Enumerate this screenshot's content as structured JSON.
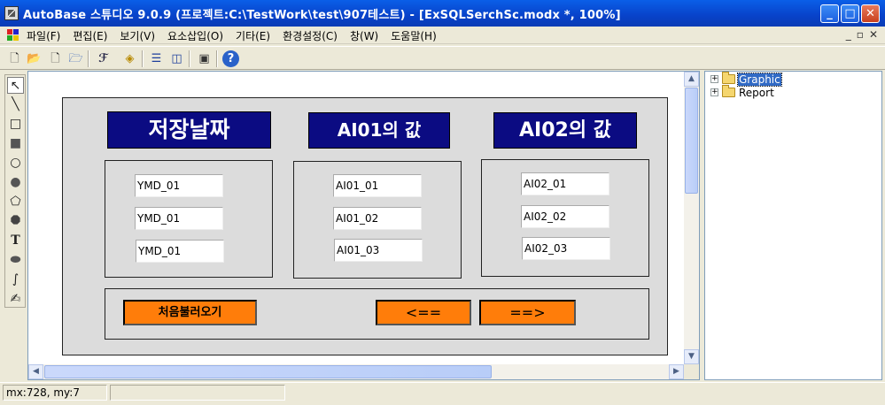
{
  "window": {
    "title": "AutoBase 스튜디오 9.0.9 (프로젝트:C:\\TestWork\\test\\907테스트) - [ExSQLSerchSc.modx *, 100%]",
    "controls": {
      "minimize": "_",
      "maximize": "□",
      "close": "✕"
    }
  },
  "menu": {
    "items": [
      "파일(F)",
      "편집(E)",
      "보기(V)",
      "요소삽입(O)",
      "기타(E)",
      "환경설정(C)",
      "창(W)",
      "도움말(H)"
    ],
    "mdi_controls": [
      "_",
      "▫",
      "✕"
    ]
  },
  "toolbar": {
    "buttons": [
      "new-file-icon",
      "open-folder-icon",
      "new-document-icon",
      "open-project-icon",
      "script-icon",
      "tag-icon",
      "split-horizontal-icon",
      "split-vertical-icon",
      "monitor-icon",
      "help-icon"
    ]
  },
  "palette": {
    "tools": [
      "select-arrow-icon",
      "line-icon",
      "rectangle-icon",
      "filled-rectangle-icon",
      "ellipse-icon",
      "filled-ellipse-icon",
      "polygon-icon",
      "filled-polygon-icon",
      "text-tool-icon",
      "round-rect-icon",
      "curve-icon",
      "pen-tool-icon"
    ],
    "text_tool_label": "T"
  },
  "design": {
    "headers": {
      "date": "저장날짜",
      "ai01": "AI01의 값",
      "ai02": "AI02의 값"
    },
    "ymd_fields": [
      "YMD_01",
      "YMD_01",
      "YMD_01"
    ],
    "ai01_fields": [
      "AI01_01",
      "AI01_02",
      "AI01_03"
    ],
    "ai02_fields": [
      "AI02_01",
      "AI02_02",
      "AI02_03"
    ],
    "buttons": {
      "load_first": "처음불러오기",
      "prev": "<==",
      "next": "==>"
    },
    "colors": {
      "header_bg": "#0b0b82",
      "button_bg": "#ff7d0a",
      "panel_bg": "#dcdcdc"
    }
  },
  "tree": {
    "items": [
      {
        "label": "Graphic",
        "selected": true
      },
      {
        "label": "Report",
        "selected": false
      }
    ]
  },
  "status": {
    "mouse": "mx:728, my:7"
  }
}
